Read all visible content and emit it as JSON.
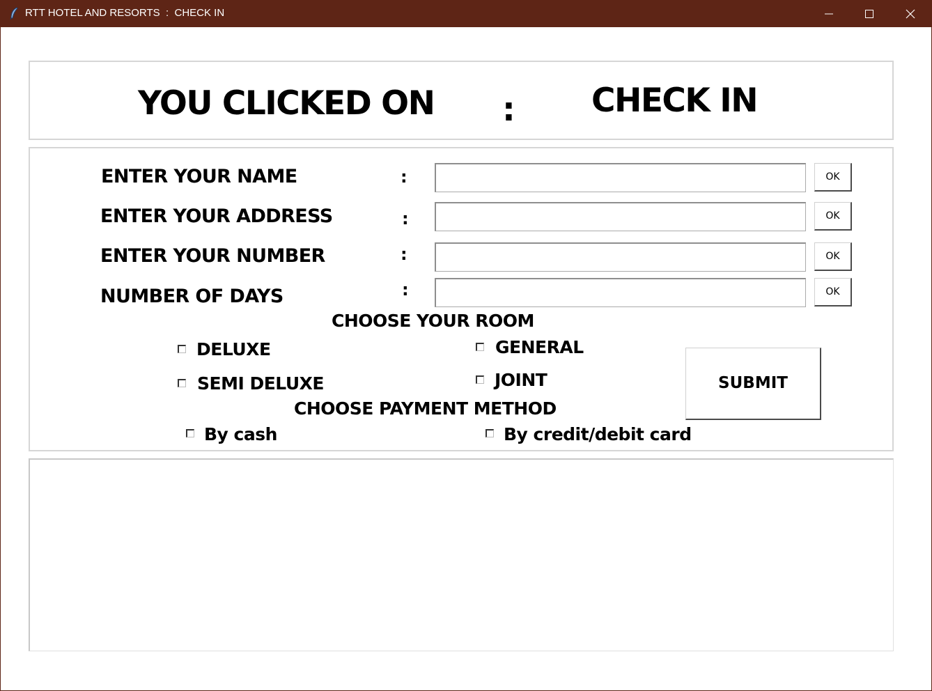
{
  "window": {
    "title": "RTT HOTEL AND RESORTS  :  CHECK IN",
    "app_icon": "feather-icon",
    "controls": [
      "minimize-icon",
      "maximize-icon",
      "close-icon"
    ],
    "titlebar_color": "#5e2516"
  },
  "header": {
    "clicked_label": "YOU CLICKED ON",
    "separator": ":",
    "action": "CHECK IN"
  },
  "form": {
    "fields": [
      {
        "label": "ENTER YOUR NAME",
        "colon": ":",
        "value": "",
        "ok_label": "OK"
      },
      {
        "label": "ENTER YOUR ADDRESS",
        "colon": ":",
        "value": "",
        "ok_label": "OK"
      },
      {
        "label": "ENTER YOUR NUMBER",
        "colon": ":",
        "value": "",
        "ok_label": "OK"
      },
      {
        "label": "NUMBER OF DAYS",
        "colon": ":",
        "value": "",
        "ok_label": "OK"
      }
    ],
    "room_heading": "CHOOSE YOUR ROOM",
    "rooms": [
      {
        "label": "DELUXE",
        "checked": false
      },
      {
        "label": "GENERAL",
        "checked": false
      },
      {
        "label": "SEMI DELUXE",
        "checked": false
      },
      {
        "label": "JOINT",
        "checked": false
      }
    ],
    "payment_heading": "CHOOSE PAYMENT METHOD",
    "payments": [
      {
        "label": "By cash",
        "checked": false
      },
      {
        "label": "By credit/debit card",
        "checked": false
      }
    ],
    "submit_label": "SUBMIT"
  }
}
